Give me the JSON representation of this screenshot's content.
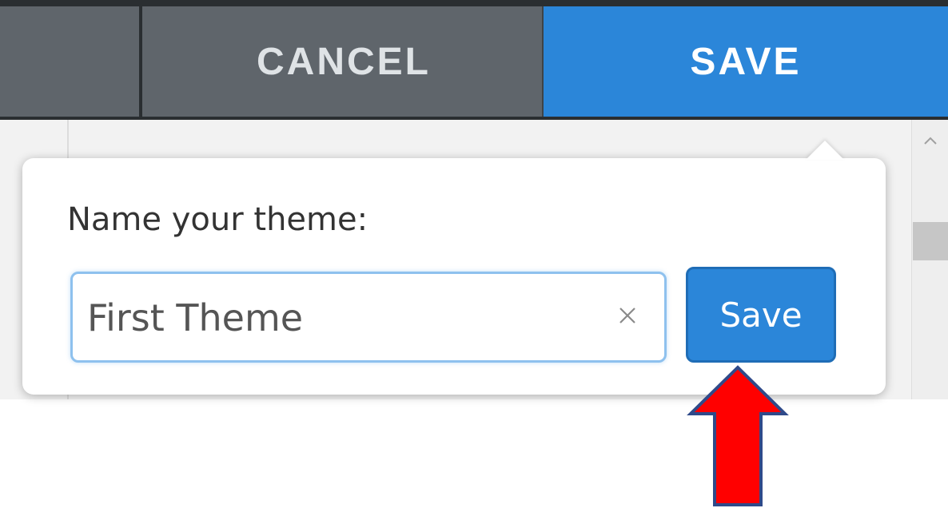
{
  "toolbar": {
    "cancel_label": "CANCEL",
    "save_label": "SAVE"
  },
  "popover": {
    "label": "Name your theme:",
    "input_value": "First Theme",
    "save_label": "Save"
  },
  "colors": {
    "accent": "#2b86d9",
    "toolbar": "#5f656b",
    "annotation_arrow": "#ff0000"
  },
  "icons": {
    "clear": "close-icon",
    "scroll_up": "chevron-up-icon",
    "annotation": "arrow-up-icon"
  }
}
